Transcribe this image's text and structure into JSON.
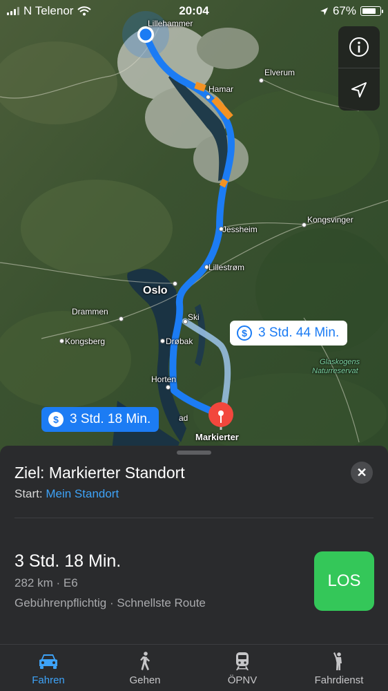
{
  "status_bar": {
    "carrier": "N Telenor",
    "time": "20:04",
    "battery": "67%",
    "battery_level": 0.67
  },
  "map": {
    "controls": {
      "info_icon": "info-icon",
      "location_icon": "location-arrow-icon"
    },
    "places": [
      {
        "name": "Lillehammer",
        "big": false
      },
      {
        "name": "Elverum",
        "big": false
      },
      {
        "name": "Hamar",
        "big": false
      },
      {
        "name": "Jessheim",
        "big": false
      },
      {
        "name": "Kongsvinger",
        "big": false
      },
      {
        "name": "Lillestrøm",
        "big": false
      },
      {
        "name": "Oslo",
        "big": true
      },
      {
        "name": "Drammen",
        "big": false
      },
      {
        "name": "Ski",
        "big": false
      },
      {
        "name": "Kongsberg",
        "big": false
      },
      {
        "name": "Drøbak",
        "big": false
      },
      {
        "name": "Horten",
        "big": false
      },
      {
        "name": "ad",
        "big": false
      }
    ],
    "park_label": [
      "Glaskogens",
      "Naturreservat"
    ],
    "route_primary_label": "3 Std. 18 Min.",
    "route_alt_label": "3 Std. 44 Min.",
    "toll_symbol": "$",
    "destination_pin_label": "Markierter"
  },
  "sheet": {
    "title": "Ziel: Markierter Standort",
    "start_prefix": "Start:",
    "start_value": "Mein Standort",
    "close_symbol": "✕",
    "route": {
      "duration": "3 Std. 18 Min.",
      "meta": "282 km · E6",
      "tags": "Gebührenpflichtig · Schnellste Route"
    },
    "go_label": "LOS"
  },
  "tabs": [
    {
      "label": "Fahren",
      "icon": "car-icon",
      "active": true
    },
    {
      "label": "Gehen",
      "icon": "walking-icon",
      "active": false
    },
    {
      "label": "ÖPNV",
      "icon": "train-icon",
      "active": false
    },
    {
      "label": "Fahrdienst",
      "icon": "rideshare-icon",
      "active": false
    }
  ],
  "colors": {
    "route_primary": "#1c7cf4",
    "route_alt": "#9cc4ea",
    "traffic": "#f39223",
    "go_button": "#34c759",
    "link": "#3ea3f8",
    "pin": "#f2473d"
  }
}
